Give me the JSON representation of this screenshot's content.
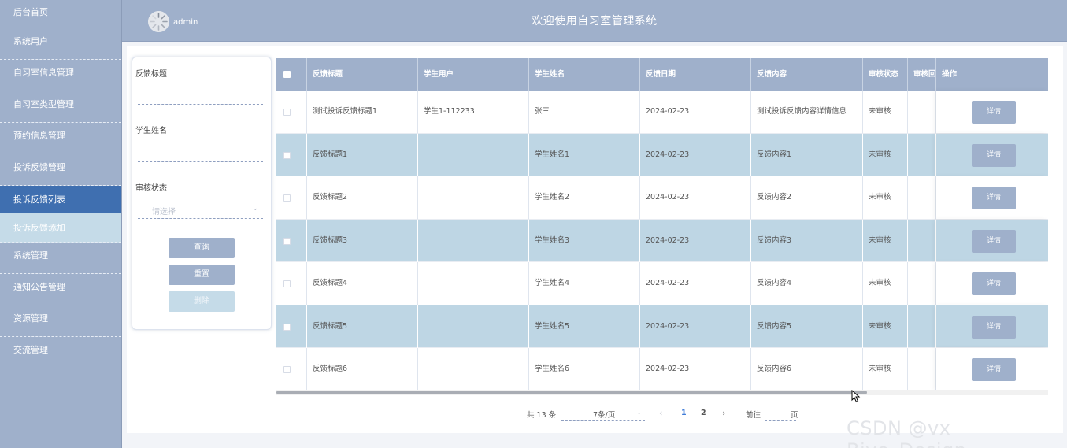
{
  "sidebar": {
    "items": [
      {
        "label": "后台首页"
      },
      {
        "label": "系统用户"
      },
      {
        "label": "自习室信息管理"
      },
      {
        "label": "自习室类型管理"
      },
      {
        "label": "预约信息管理"
      },
      {
        "label": "投诉反馈管理"
      },
      {
        "label": "投诉反馈列表"
      },
      {
        "label": "投诉反馈添加"
      },
      {
        "label": "系统管理"
      },
      {
        "label": "通知公告管理"
      },
      {
        "label": "资源管理"
      },
      {
        "label": "交流管理"
      }
    ]
  },
  "header": {
    "username": "admin",
    "title": "欢迎使用自习室管理系统"
  },
  "search": {
    "title_label": "反馈标题",
    "name_label": "学生姓名",
    "status_label": "审核状态",
    "status_placeholder": "请选择",
    "query_btn": "查询",
    "reset_btn": "重置",
    "delete_btn": "删除"
  },
  "table": {
    "columns": [
      "反馈标题",
      "学生用户",
      "学生姓名",
      "反馈日期",
      "反馈内容",
      "审核状态",
      "审核回复",
      "操作"
    ],
    "detail_label": "详情",
    "rows": [
      {
        "title": "测试投诉反馈标题1",
        "user": "学生1-112233",
        "name": "张三",
        "date": "2024-02-23",
        "content": "测试投诉反馈内容详情信息",
        "status": "未审核"
      },
      {
        "title": "反馈标题1",
        "user": "",
        "name": "学生姓名1",
        "date": "2024-02-23",
        "content": "反馈内容1",
        "status": "未审核"
      },
      {
        "title": "反馈标题2",
        "user": "",
        "name": "学生姓名2",
        "date": "2024-02-23",
        "content": "反馈内容2",
        "status": "未审核"
      },
      {
        "title": "反馈标题3",
        "user": "",
        "name": "学生姓名3",
        "date": "2024-02-23",
        "content": "反馈内容3",
        "status": "未审核"
      },
      {
        "title": "反馈标题4",
        "user": "",
        "name": "学生姓名4",
        "date": "2024-02-23",
        "content": "反馈内容4",
        "status": "未审核"
      },
      {
        "title": "反馈标题5",
        "user": "",
        "name": "学生姓名5",
        "date": "2024-02-23",
        "content": "反馈内容5",
        "status": "未审核"
      },
      {
        "title": "反馈标题6",
        "user": "",
        "name": "学生姓名6",
        "date": "2024-02-23",
        "content": "反馈内容6",
        "status": "未审核"
      }
    ]
  },
  "pager": {
    "total": "共 13 条",
    "page_size": "7条/页",
    "pages": [
      "1",
      "2"
    ],
    "current_page": "1",
    "goto_label": "前往",
    "page_label": "页"
  },
  "watermark": "CSDN @vx Biye_Design",
  "colors": {
    "sidebar_bg": "#9fb0cb",
    "active_menu": "#3f6fb0",
    "stripe_row": "#bed6e4",
    "button": "#9fb0cb"
  }
}
